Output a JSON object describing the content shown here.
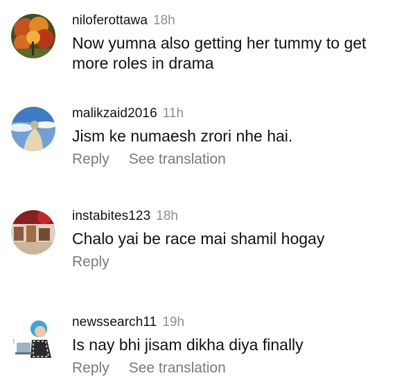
{
  "comments": [
    {
      "username": "niloferottawa",
      "time": "18h",
      "text": "Now yumna also getting her tummy to get more roles in drama",
      "avatar_icon": "autumn-tree-photo",
      "actions": []
    },
    {
      "username": "malikzaid2016",
      "time": "11h",
      "text": "Jism ke numaesh zrori nhe hai.",
      "avatar_icon": "sky-photo",
      "actions": [
        "Reply",
        "See translation"
      ]
    },
    {
      "username": "instabites123",
      "time": "18h",
      "text": "Chalo yai be race mai shamil hogay",
      "avatar_icon": "food-photo",
      "actions": [
        "Reply"
      ]
    },
    {
      "username": "newssearch11",
      "time": "19h",
      "text": "Is nay bhi jisam dikha diya finally",
      "avatar_icon": "news-reader-illustration",
      "actions": [
        "Reply",
        "See translation"
      ]
    }
  ]
}
